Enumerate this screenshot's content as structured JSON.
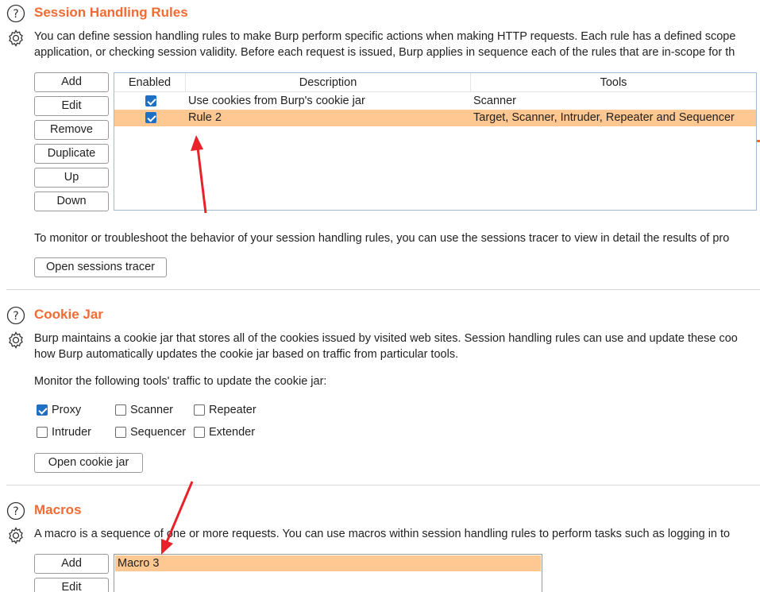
{
  "session_rules": {
    "title": "Session Handling Rules",
    "desc_line1": "You can define session handling rules to make Burp perform specific actions when making HTTP requests. Each rule has a defined scope",
    "desc_line2": "application, or checking session validity. Before each request is issued, Burp applies in sequence each of the rules that are in-scope for th",
    "buttons": {
      "add": "Add",
      "edit": "Edit",
      "remove": "Remove",
      "duplicate": "Duplicate",
      "up": "Up",
      "down": "Down"
    },
    "table": {
      "headers": {
        "enabled": "Enabled",
        "description": "Description",
        "tools": "Tools"
      },
      "rows": [
        {
          "enabled": true,
          "description": "Use cookies from Burp's cookie jar",
          "tools": "Scanner"
        },
        {
          "enabled": true,
          "description": "Rule 2",
          "tools": "Target, Scanner, Intruder, Repeater and Sequencer"
        }
      ]
    },
    "tracer_text": "To monitor or troubleshoot the behavior of your session handling rules, you can use the sessions tracer to view in detail the results of pro",
    "tracer_button": "Open sessions tracer"
  },
  "cookie_jar": {
    "title": "Cookie Jar",
    "desc_line1": "Burp maintains a cookie jar that stores all of the cookies issued by visited web sites. Session handling rules can use and update these coo",
    "desc_line2": "how Burp automatically updates the cookie jar based on traffic from particular tools.",
    "monitor_label": "Monitor the following tools' traffic to update the cookie jar:",
    "tools": [
      {
        "label": "Proxy",
        "checked": true
      },
      {
        "label": "Scanner",
        "checked": false
      },
      {
        "label": "Repeater",
        "checked": false
      },
      {
        "label": "Intruder",
        "checked": false
      },
      {
        "label": "Sequencer",
        "checked": false
      },
      {
        "label": "Extender",
        "checked": false
      }
    ],
    "open_button": "Open cookie jar"
  },
  "macros": {
    "title": "Macros",
    "desc_line1": "A macro is a sequence of one or more requests. You can use macros within session handling rules to perform tasks such as logging in to",
    "buttons": {
      "add": "Add",
      "edit": "Edit"
    },
    "items": [
      "Macro 3"
    ]
  },
  "colors": {
    "accent": "#f26b33",
    "selection": "#ffc791",
    "checkbox": "#1f6fc5",
    "annotation_arrow": "#e8222a"
  }
}
